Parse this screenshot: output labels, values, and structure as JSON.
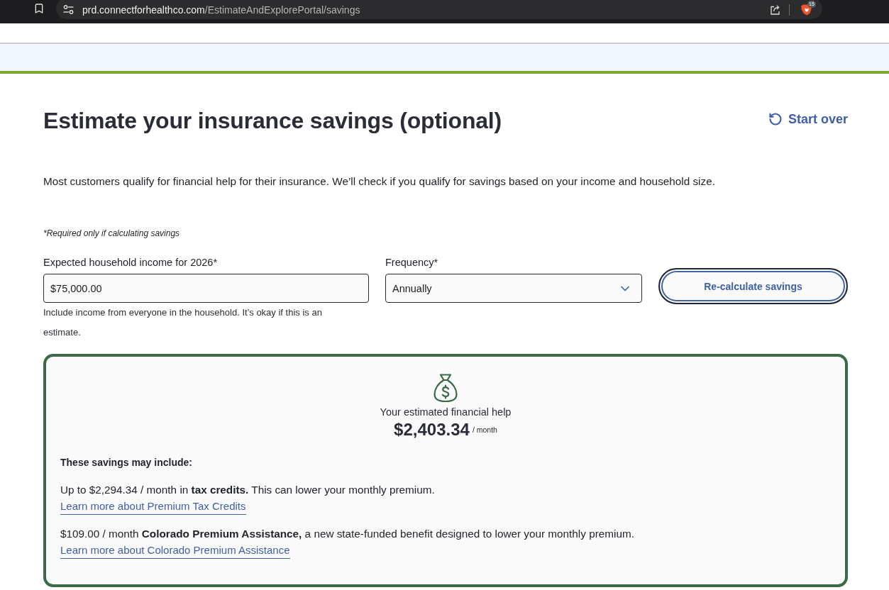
{
  "browser": {
    "url": {
      "host": "prd.connectforhealthco.com",
      "path": "/EstimateAndExplorePortal/savings"
    },
    "extension_badge": "15"
  },
  "header": {
    "title": "Estimate your insurance savings (optional)",
    "start_over": "Start over"
  },
  "intro": "Most customers qualify for financial help for their insurance. We’ll check if you qualify for savings based on your income and household size.",
  "required_note": "*Required only if calculating savings",
  "form": {
    "income": {
      "label": "Expected household income for 2026*",
      "value": "$75,000.00",
      "hint": "Include income from everyone in the household. It’s okay if this is an estimate."
    },
    "frequency": {
      "label": "Frequency*",
      "value": "Annually"
    },
    "button": "Re-calculate savings"
  },
  "result": {
    "caption": "Your estimated financial help",
    "amount": "$2,403.34",
    "unit": "/ month",
    "heading": "These savings may include:",
    "items": [
      {
        "text": "Up to $2,294.34 / month in **tax credits.** This can lower your monthly premium.",
        "link": "Learn more about Premium Tax Credits"
      },
      {
        "text": "$109.00 / month **Colorado Premium Assistance,** a new state-funded benefit designed to lower your monthly premium.",
        "link": "Learn more about Colorado Premium Assistance"
      }
    ]
  }
}
